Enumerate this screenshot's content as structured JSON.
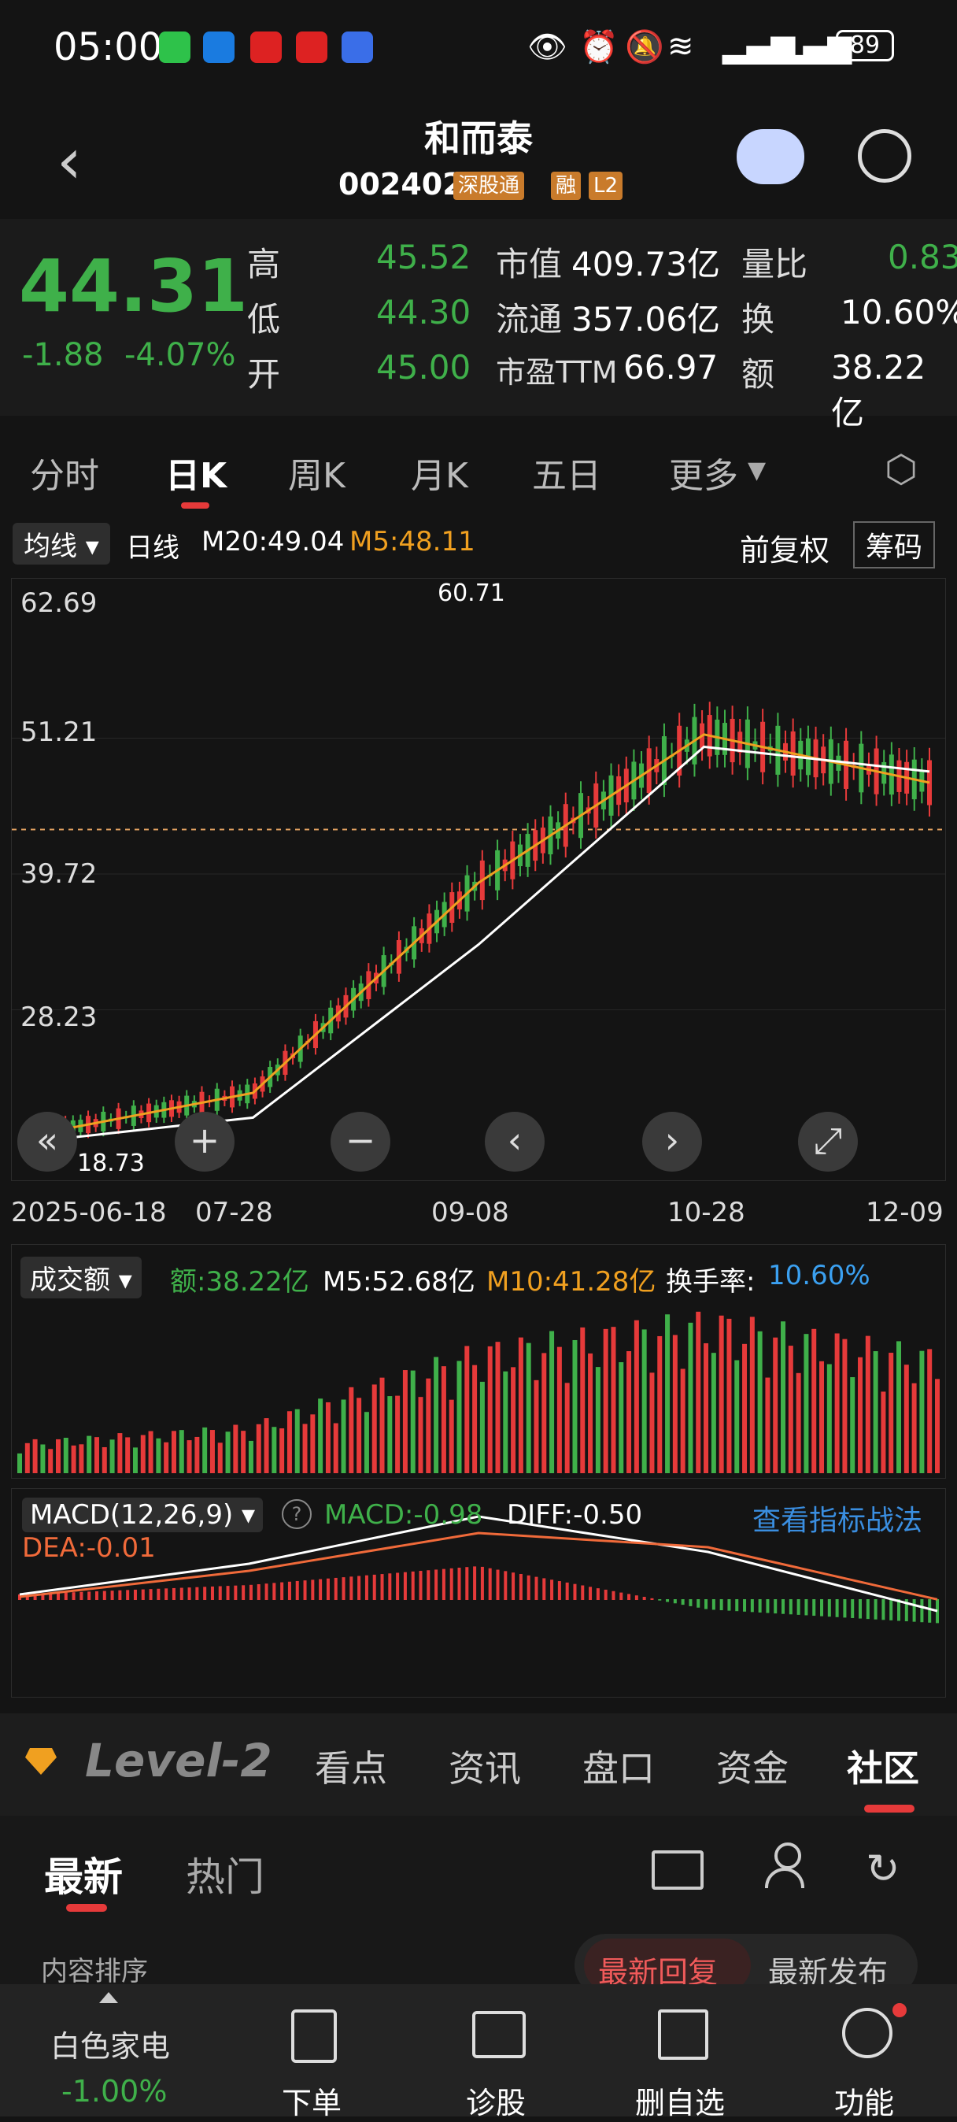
{
  "status_bar": {
    "time": "05:00",
    "battery": "89"
  },
  "header": {
    "title": "和而泰",
    "code": "002402",
    "tags": [
      "深股通",
      "融",
      "L2"
    ]
  },
  "quote": {
    "price": "44.31",
    "change": "-1.88",
    "change_pct": "-4.07%",
    "fields": [
      {
        "label": "高",
        "value": "45.52"
      },
      {
        "label": "低",
        "value": "44.30"
      },
      {
        "label": "开",
        "value": "45.00"
      },
      {
        "label": "市值",
        "value": "409.73亿"
      },
      {
        "label": "流通",
        "value": "357.06亿"
      },
      {
        "label": "市盈TTM",
        "value": "66.97"
      },
      {
        "label": "量比",
        "value": "0.83"
      },
      {
        "label": "换",
        "value": "10.60%"
      },
      {
        "label": "额",
        "value": "38.22亿"
      }
    ]
  },
  "tabs": [
    "分时",
    "日K",
    "周K",
    "月K",
    "五日",
    "更多"
  ],
  "kline_header": {
    "ma_select": "均线",
    "period": "日线",
    "m20": "M20:49.04",
    "m5": "M5:48.11",
    "adjust": "前复权",
    "chips": "筹码"
  },
  "kline": {
    "y_ticks": [
      "62.69",
      "51.21",
      "39.72",
      "28.23"
    ],
    "high_label": "60.71",
    "low_label": "18.73",
    "x_ticks": [
      "2025-06-18",
      "07-28",
      "09-08",
      "10-28",
      "12-09"
    ],
    "controls": [
      "«",
      "+",
      "−",
      "‹",
      "›",
      "⤢"
    ]
  },
  "chart_data": [
    {
      "type": "line",
      "title": "",
      "xlabel": "",
      "ylabel": "",
      "x": [
        "2025-06-18",
        "07-28",
        "09-08",
        "10-28",
        "12-09"
      ],
      "ylim": [
        18.73,
        62.69
      ],
      "series": [
        {
          "name": "M5",
          "values": [
            19.5,
            23,
            40,
            52,
            48.1
          ]
        },
        {
          "name": "M20",
          "values": [
            19,
            21,
            35,
            51,
            49.0
          ]
        }
      ]
    },
    {
      "type": "bar",
      "title": "",
      "categories": [
        "2025-06-18",
        "07-28",
        "09-08",
        "10-28",
        "12-09"
      ],
      "values": [
        10,
        15,
        40,
        50,
        38.22
      ]
    },
    {
      "type": "line",
      "title": "",
      "x": [
        "2025-06-18",
        "07-28",
        "09-08",
        "10-28",
        "12-09"
      ],
      "series": [
        {
          "name": "DIFF",
          "values": [
            0.2,
            1.5,
            3.5,
            2,
            -0.5
          ]
        },
        {
          "name": "DEA",
          "values": [
            0.1,
            1.2,
            2.8,
            2.2,
            -0.01
          ]
        }
      ]
    }
  ],
  "volume_header": {
    "select": "成交额",
    "amount": "额:38.22亿",
    "m5": "M5:52.68亿",
    "m10": "M10:41.28亿",
    "turnover_label": "换手率:",
    "turnover": "10.60%"
  },
  "macd_header": {
    "select": "MACD(12,26,9)",
    "help": "?",
    "macd": "MACD:-0.98",
    "diff": "DIFF:-0.50",
    "link": "查看指标战法",
    "dea": "DEA:-0.01"
  },
  "info_tabs": [
    "Level-2",
    "看点",
    "资讯",
    "盘口",
    "资金",
    "社区"
  ],
  "social": {
    "tabs": [
      "最新",
      "热门"
    ],
    "sort_label": "内容排序",
    "sort_options": [
      "最新回复",
      "最新发布"
    ]
  },
  "footer": {
    "ticker_name": "白色家电",
    "ticker_change": "-1.00%",
    "items": [
      "下单",
      "诊股",
      "删自选",
      "功能"
    ]
  },
  "colors": {
    "up": "#e63a3a",
    "down": "#3fb04a",
    "m5": "#f0a020",
    "m20": "#ffffff",
    "accent": "#e63a3a"
  }
}
